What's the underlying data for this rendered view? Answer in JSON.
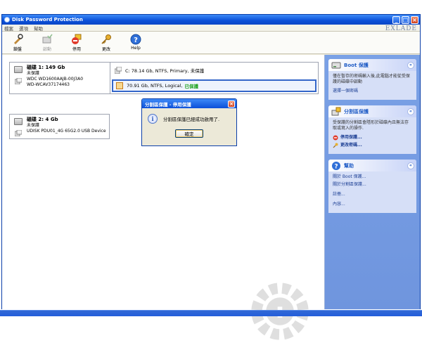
{
  "window": {
    "title": "Disk Password Protection",
    "brand": "EXLADE"
  },
  "menu": [
    "檔案",
    "選項",
    "幫助"
  ],
  "toolbar": [
    {
      "label": "鎖盤",
      "icon": "lock-icon",
      "enabled": true
    },
    {
      "label": "啟動",
      "icon": "disk-check-icon",
      "enabled": false
    },
    {
      "label": "停用",
      "icon": "disable-icon",
      "enabled": true
    },
    {
      "label": "更改",
      "icon": "key-icon",
      "enabled": true
    },
    {
      "label": "Help",
      "icon": "help-icon",
      "enabled": true
    }
  ],
  "disks": [
    {
      "title": "磁碟 1: 149 Gb",
      "status": "未保護",
      "model": "WDC WD1600AAJB-00J3A0",
      "serial": "WD-WCAV37174463",
      "partitions": [
        {
          "text": "C: 78.14 Gb, NTFS, Primary, 未保護",
          "protected_label": ""
        },
        {
          "text": "70.91 Gb, NTFS, Logical,",
          "protected_label": "已保護"
        }
      ]
    },
    {
      "title": "磁碟 2: 4 Gb",
      "status": "未保護",
      "model": "UDISK PDU01_4G 65G2.0 USB Device",
      "serial": "",
      "partitions": []
    }
  ],
  "sidebar": {
    "boot": {
      "title": "Boot 保護",
      "desc": "僅在暫存的密碼輸入後,此電腦才能從受保護的磁碟中啟動",
      "link": "選擇一個密碼"
    },
    "partition": {
      "title": "分割區保護",
      "desc": "受保護的分割區會隱形於磁碟內且無法存取或寫入的操作.",
      "action1": "停用保護...",
      "action2": "更改密碼..."
    },
    "help": {
      "title": "幫助",
      "links": [
        "關於 Boot 保護...",
        "關於分割區保護...",
        "註冊...",
        "內容..."
      ]
    }
  },
  "dialog": {
    "title": "分割區保護 - 停用保護",
    "message": "分割區保護已經成功啟用了.",
    "ok_label": "確定"
  }
}
